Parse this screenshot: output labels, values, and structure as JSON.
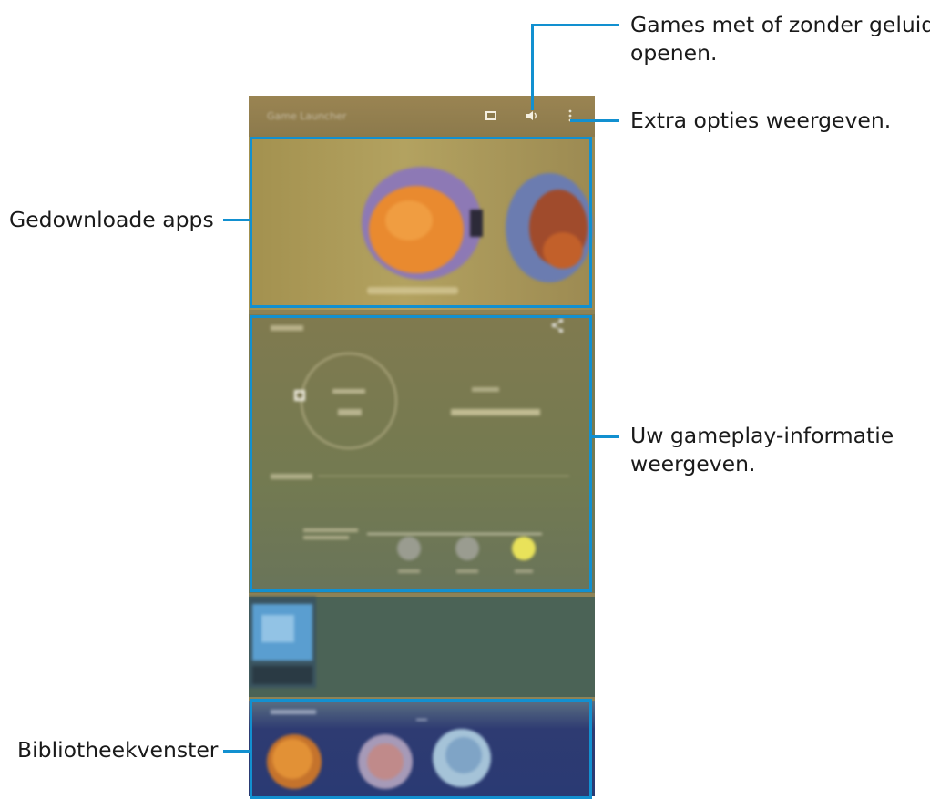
{
  "screen": {
    "app_title": "Game Launcher",
    "toolbar": {
      "screen_icon": "screen-icon",
      "sound_icon": "sound-icon",
      "more_icon": "more-options-icon"
    },
    "games": {
      "caption": "Game launcher apps"
    },
    "stats": {
      "title": "Wie ben je",
      "share_icon": "share-icon",
      "ring_label": "Speeltijd",
      "ring_value": "0 min",
      "right_label": "Favoriet",
      "right_value": "Geen favoriete app",
      "bar_label": "Speeltijd deze week",
      "level_label": "Speeltijd\nniveau",
      "level_buttons": [
        "Eenvoudig",
        "Gemiddeld",
        "Moeilijk"
      ]
    },
    "library": {
      "title": "Bibliotheek"
    }
  },
  "callouts": {
    "sound": {
      "line1": "Games met of zonder geluid",
      "line2": "openen."
    },
    "options": {
      "line1": "Extra opties weergeven."
    },
    "games": {
      "line1": "Gedownloade apps"
    },
    "stats": {
      "line1": "Uw gameplay-informatie",
      "line2": "weergeven."
    },
    "library": {
      "line1": "Bibliotheekvenster"
    }
  },
  "colors": {
    "highlight": "#1290d0",
    "callout_text": "#1a1a1a"
  }
}
